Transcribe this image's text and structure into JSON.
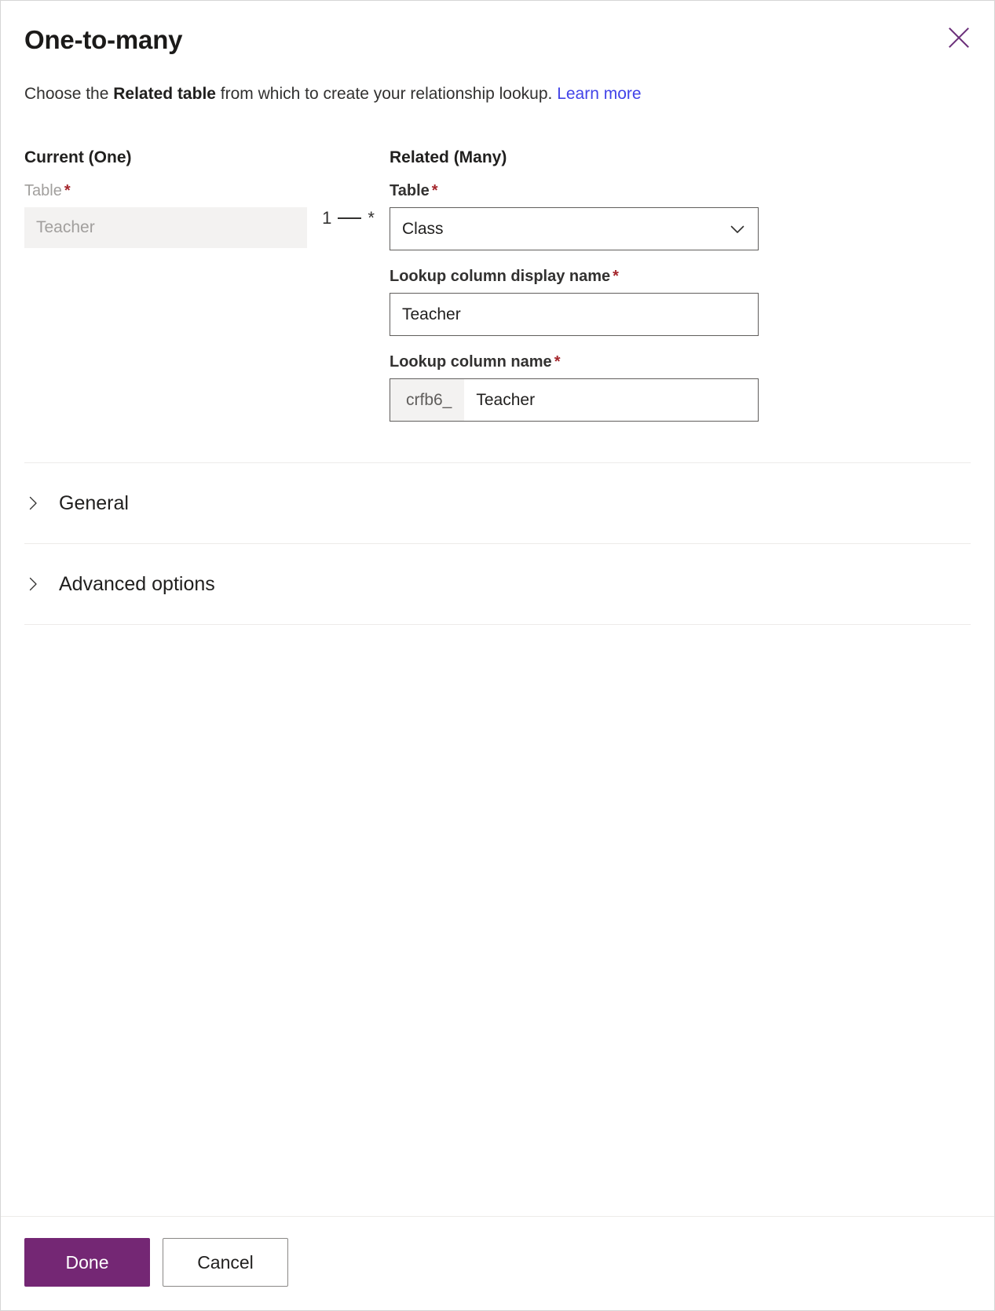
{
  "dialog": {
    "title": "One-to-many",
    "close_icon": "close-icon"
  },
  "description": {
    "lead": "Choose the ",
    "bold": "Related table",
    "rest": " from which to create your relationship lookup. ",
    "link": "Learn more"
  },
  "current": {
    "heading": "Current (One)",
    "table_label": "Table",
    "required_marker": "*",
    "table_value": "Teacher"
  },
  "cardinality": {
    "one": "1",
    "many": "*"
  },
  "related": {
    "heading": "Related (Many)",
    "table_label": "Table",
    "required_marker": "*",
    "table_value": "Class",
    "table_chevron_icon": "chevron-down-icon",
    "display_name_label": "Lookup column display name",
    "display_name_value": "Teacher",
    "column_name_label": "Lookup column name",
    "column_name_prefix": "crfb6_",
    "column_name_value": "Teacher"
  },
  "sections": [
    {
      "label": "General",
      "icon": "chevron-right-icon",
      "expanded": false
    },
    {
      "label": "Advanced options",
      "icon": "chevron-right-icon",
      "expanded": false
    }
  ],
  "footer": {
    "done_label": "Done",
    "cancel_label": "Cancel"
  },
  "colors": {
    "primary": "#742774",
    "link": "#4243e8",
    "required": "#a4262c",
    "text": "#201f1e",
    "disabled_text": "#a19f9d",
    "disabled_bg": "#f3f2f1",
    "border": "#605e5c",
    "divider": "#edebe9"
  }
}
